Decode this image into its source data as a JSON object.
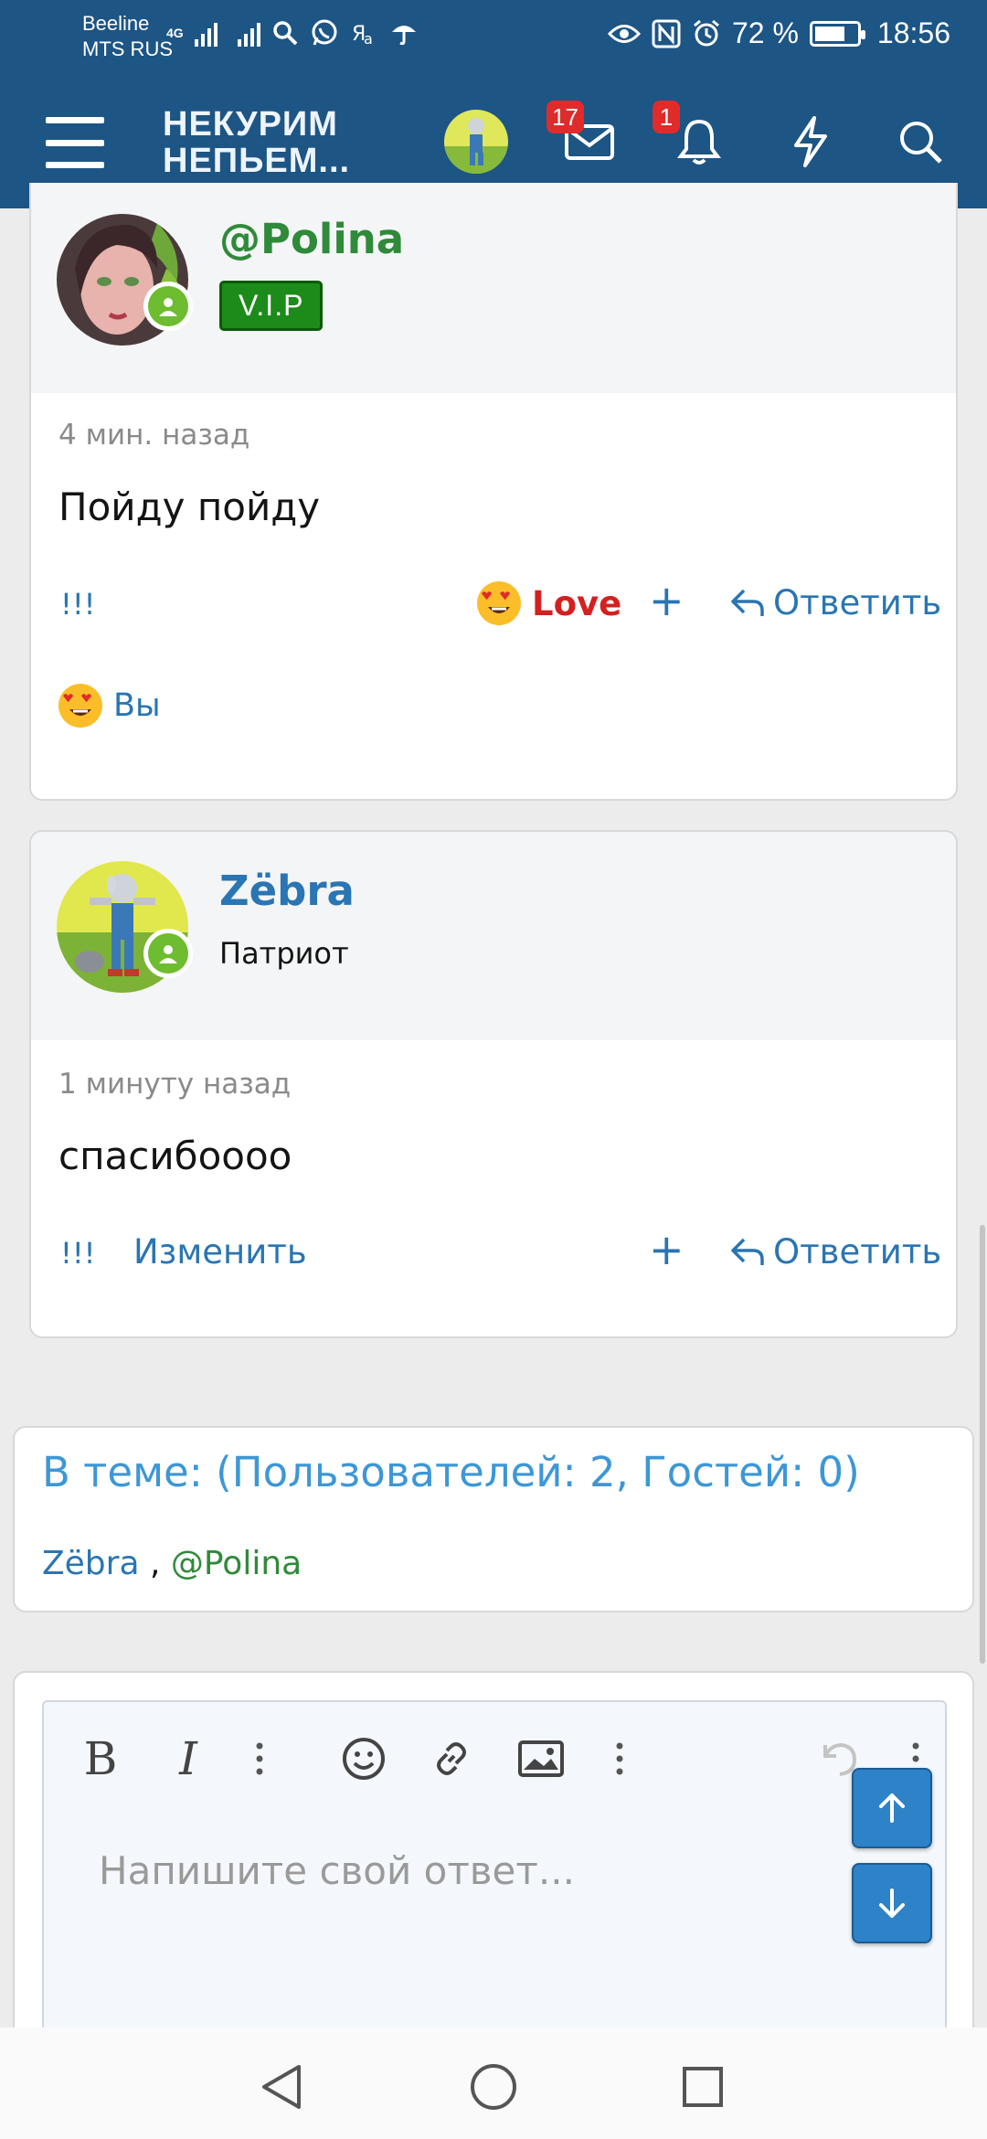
{
  "status_bar": {
    "carrier_line1": "Beeline",
    "carrier_line2": "MTS RUS",
    "network": "4G",
    "battery": "72 %",
    "battery_level": 0.72,
    "time": "18:56"
  },
  "header": {
    "logo_line1": "НЕКУРИМ",
    "logo_line2": "НЕПЬЕМ...",
    "inbox_badge": "17",
    "alerts_badge": "1"
  },
  "posts": [
    {
      "username": "@Polina",
      "username_color": "#2f8a3a",
      "badge": "V.I.P",
      "time": "4 мин. назад",
      "message": "Пойду пойду",
      "action_left": "!!!",
      "reaction_label": "Love",
      "add": "+",
      "reply": "Ответить",
      "reacted_by": "Вы"
    },
    {
      "username": "Zëbra",
      "username_color": "#2a75b3",
      "role": "Патриот",
      "time": "1 минуту назад",
      "message": "спасибоооо",
      "action_left": "!!!",
      "edit": "Изменить",
      "add": "+",
      "reply": "Ответить"
    }
  ],
  "online": {
    "title": "В теме: (Пользователей: 2, Гостей: 0)",
    "user1": "Zëbra",
    "separator": " , ",
    "user2": "@Polina"
  },
  "editor": {
    "placeholder": "Напишите свой ответ..."
  },
  "colors": {
    "header_bg": "#1d5585",
    "link_blue": "#2a75b3",
    "vip_green": "#1d8b1a",
    "love_red": "#d32020",
    "badge_red": "#e02b2b"
  }
}
